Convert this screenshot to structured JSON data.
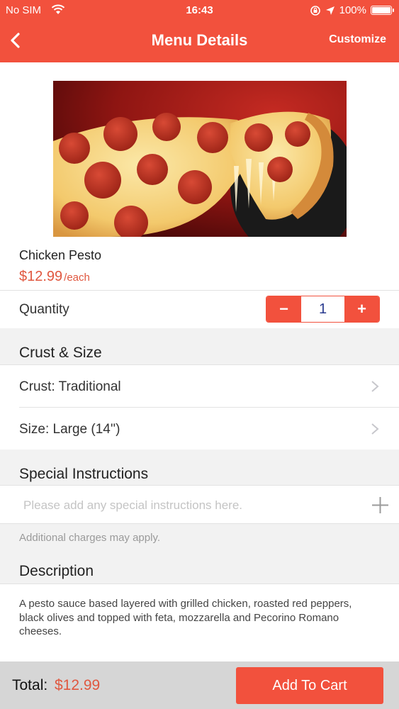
{
  "status_bar": {
    "carrier": "No SIM",
    "time": "16:43",
    "battery_text": "100%",
    "battery_level": 1.0
  },
  "navbar": {
    "back_icon": "chevron-left-icon",
    "title": "Menu Details",
    "right_action": "Customize"
  },
  "item": {
    "image": "pepperoni-pizza-photo",
    "name": "Chicken Pesto",
    "price": "$12.99",
    "unit": "/each"
  },
  "quantity": {
    "label": "Quantity",
    "decrement": "−",
    "value": "1",
    "increment": "+"
  },
  "crust_size": {
    "heading": "Crust & Size",
    "crust": "Crust: Traditional",
    "size": "Size: Large (14'')"
  },
  "special_instructions": {
    "heading": "Special Instructions",
    "placeholder": "Please add any special instructions here.",
    "value": "",
    "note": "Additional charges may apply."
  },
  "description": {
    "heading": "Description",
    "text": "A pesto sauce based layered with grilled chicken, roasted red peppers, black olives and topped with feta, mozzarella and Pecorino Romano cheeses."
  },
  "footer": {
    "total_label": "Total:",
    "total_value": "$12.99",
    "add_button": "Add To Cart"
  },
  "colors": {
    "brand": "#f2513d",
    "price": "#e0573f",
    "section_bg": "#f2f2f2",
    "footer_bg": "#d6d6d6"
  }
}
